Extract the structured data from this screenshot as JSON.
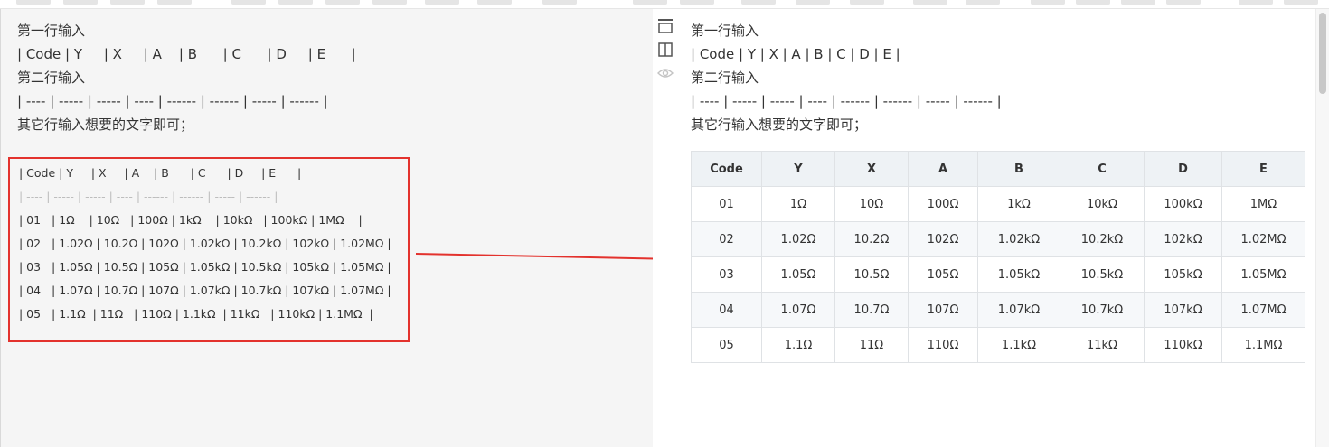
{
  "colors": {
    "highlight_border": "#e3322d",
    "arrow": "#e3322d",
    "editor_bg": "#f5f5f5"
  },
  "editor": {
    "instructions": {
      "line1": "第一行输入",
      "line2": "| Code | Y     | X     | A    | B      | C      | D     | E      |",
      "line3": "第二行输入",
      "line4": "| ---- | ----- | ----- | ---- | ------ | ------ | ----- | ------ |",
      "line5": "其它行输入想要的文字即可；"
    },
    "code": {
      "header": "| Code | Y     | X     | A    | B      | C      | D     | E      |",
      "separator": "| ---- | ----- | ----- | ---- | ------ | ------ | ----- | ------ |",
      "rows": [
        "| 01   | 1Ω    | 10Ω   | 100Ω | 1kΩ    | 10kΩ   | 100kΩ | 1MΩ    |",
        "| 02   | 1.02Ω | 10.2Ω | 102Ω | 1.02kΩ | 10.2kΩ | 102kΩ | 1.02MΩ |",
        "| 03   | 1.05Ω | 10.5Ω | 105Ω | 1.05kΩ | 10.5kΩ | 105kΩ | 1.05MΩ |",
        "| 04   | 1.07Ω | 10.7Ω | 107Ω | 1.07kΩ | 10.7kΩ | 107kΩ | 1.07MΩ |",
        "| 05   | 1.1Ω  | 11Ω   | 110Ω | 1.1kΩ  | 11kΩ   | 110kΩ | 1.1MΩ  |"
      ]
    }
  },
  "preview": {
    "icons": [
      "toolbar-toggle-icon",
      "split-view-icon",
      "preview-eye-icon"
    ],
    "instructions": {
      "line1": "第一行输入",
      "line2": "| Code | Y | X | A | B | C | D | E |",
      "line3": "第二行输入",
      "line4": "| ---- | ----- | ----- | ---- | ------ | ------ | ----- | ------ |",
      "line5": "其它行输入想要的文字即可；"
    },
    "table": {
      "headers": [
        "Code",
        "Y",
        "X",
        "A",
        "B",
        "C",
        "D",
        "E"
      ],
      "rows": [
        [
          "01",
          "1Ω",
          "10Ω",
          "100Ω",
          "1kΩ",
          "10kΩ",
          "100kΩ",
          "1MΩ"
        ],
        [
          "02",
          "1.02Ω",
          "10.2Ω",
          "102Ω",
          "1.02kΩ",
          "10.2kΩ",
          "102kΩ",
          "1.02MΩ"
        ],
        [
          "03",
          "1.05Ω",
          "10.5Ω",
          "105Ω",
          "1.05kΩ",
          "10.5kΩ",
          "105kΩ",
          "1.05MΩ"
        ],
        [
          "04",
          "1.07Ω",
          "10.7Ω",
          "107Ω",
          "1.07kΩ",
          "10.7kΩ",
          "107kΩ",
          "1.07MΩ"
        ],
        [
          "05",
          "1.1Ω",
          "11Ω",
          "110Ω",
          "1.1kΩ",
          "11kΩ",
          "110kΩ",
          "1.1MΩ"
        ]
      ]
    }
  }
}
